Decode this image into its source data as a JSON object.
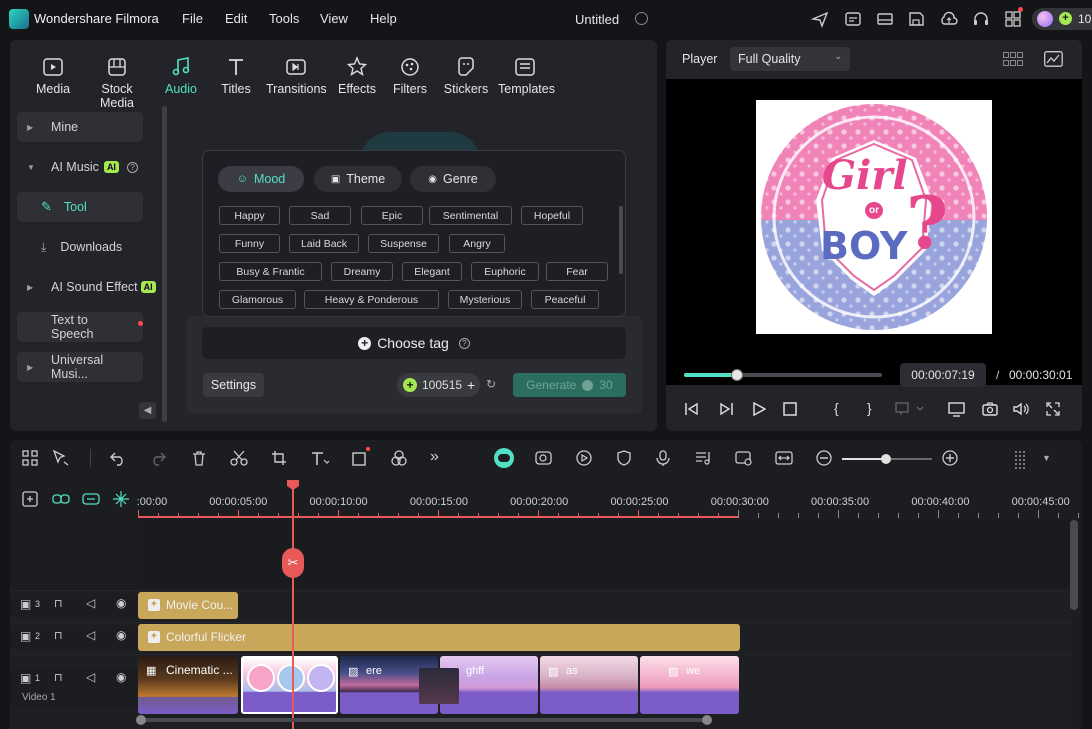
{
  "app": {
    "name": "Wondershare Filmora",
    "project_title": "Untitled",
    "menu": [
      "File",
      "Edit",
      "Tools",
      "View",
      "Help"
    ],
    "credits_partial": "10"
  },
  "categories": [
    {
      "label": "Media",
      "icon": "media-icon"
    },
    {
      "label": "Stock Media",
      "icon": "stock-media-icon"
    },
    {
      "label": "Audio",
      "icon": "audio-icon",
      "active": true
    },
    {
      "label": "Titles",
      "icon": "titles-icon"
    },
    {
      "label": "Transitions",
      "icon": "transitions-icon"
    },
    {
      "label": "Effects",
      "icon": "effects-icon"
    },
    {
      "label": "Filters",
      "icon": "filters-icon"
    },
    {
      "label": "Stickers",
      "icon": "stickers-icon"
    },
    {
      "label": "Templates",
      "icon": "templates-icon"
    }
  ],
  "sidebar": {
    "mine": "Mine",
    "ai_music": "AI Music",
    "ai_badge": "AI",
    "tool": "Tool",
    "downloads": "Downloads",
    "ai_sound_effect": "AI Sound Effect",
    "tts": "Text to Speech",
    "universal": "Universal Musi..."
  },
  "popover": {
    "tabs": [
      "Mood",
      "Theme",
      "Genre"
    ],
    "active_tab": "Mood",
    "tag_rows": [
      [
        "Happy",
        "Sad",
        "Epic",
        "Sentimental",
        "Hopeful"
      ],
      [
        "Funny",
        "Laid Back",
        "Suspense",
        "Angry"
      ],
      [
        "Busy & Frantic",
        "Dreamy",
        "Elegant",
        "Euphoric",
        "Fear"
      ],
      [
        "Glamorous",
        "Heavy & Ponderous",
        "Mysterious",
        "Peaceful"
      ]
    ]
  },
  "generator": {
    "choose_tag": "Choose tag",
    "settings": "Settings",
    "credits": "100515",
    "generate": "Generate",
    "cost": "30"
  },
  "player": {
    "label": "Player",
    "quality": "Full Quality",
    "current_time": "00:00:07:19",
    "separator": "/",
    "total_time": "00:00:30:01",
    "progress": 0.27,
    "preview": {
      "line1": "Girl",
      "line2": "or",
      "line3": "BOY",
      "mark": "?"
    }
  },
  "timeline": {
    "ruler": [
      ":00:00",
      "00:00:05:00",
      "00:00:10:00",
      "00:00:15:00",
      "00:00:20:00",
      "00:00:25:00",
      "00:00:30:00",
      "00:00:35:00",
      "00:00:40:00",
      "00:00:45:00"
    ],
    "tracks": [
      {
        "num": "3"
      },
      {
        "num": "2"
      },
      {
        "num": "1",
        "name": "Video 1"
      }
    ],
    "clips": {
      "movie": "Movie Cou...",
      "flicker": "Colorful Flicker",
      "cinematic": "Cinematic ...",
      "c2": "ere",
      "c3": "ghff",
      "c4": "as",
      "c5": "we"
    }
  },
  "colors": {
    "accent": "#52e0c4",
    "playhead": "#e85a5a",
    "effect_clip": "#c9a75a",
    "video_clip": "#7c5cc9"
  }
}
